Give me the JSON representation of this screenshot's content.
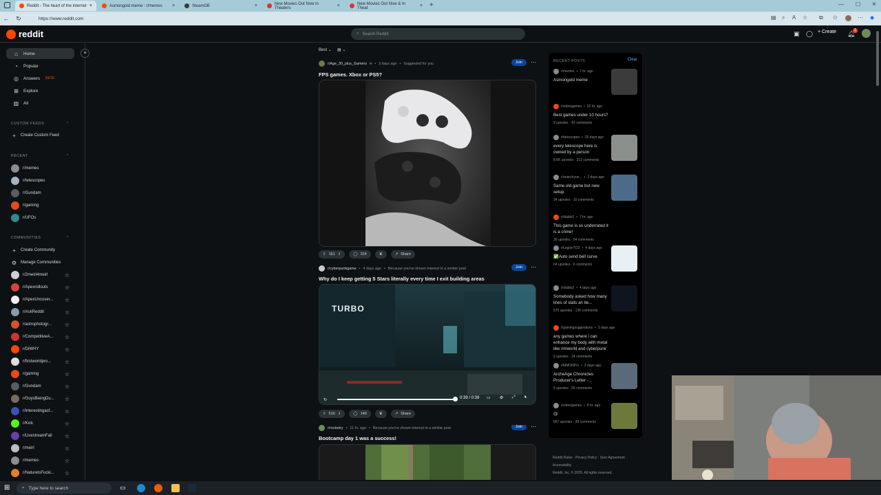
{
  "browser": {
    "tabs": [
      {
        "label": "Reddit - The heart of the internet",
        "active": true,
        "color": "#ff4500"
      },
      {
        "label": "Asmongold meme : r/memes",
        "active": false,
        "color": "#ff4500"
      },
      {
        "label": "SteamDB",
        "active": false,
        "color": "#3a3a3a"
      },
      {
        "label": "New Movies Out Now in Theaters",
        "active": false,
        "color": "#e0332f"
      },
      {
        "label": "New Movies Out Now & In Theat",
        "active": false,
        "color": "#e0332f"
      }
    ],
    "new_tab_icon": "plus-icon",
    "url": "https://www.reddit.com"
  },
  "header": {
    "logo_text": "reddit",
    "search_placeholder": "Search Reddit",
    "create_label": "Create",
    "notification_count": "1"
  },
  "sidebar": {
    "nav": [
      {
        "label": "Home",
        "icon": "home-icon",
        "active": true
      },
      {
        "label": "Popular",
        "icon": "popular-icon"
      },
      {
        "label": "Answers",
        "icon": "answers-icon",
        "badge": "BETA"
      },
      {
        "label": "Explore",
        "icon": "explore-icon"
      },
      {
        "label": "All",
        "icon": "all-icon"
      }
    ],
    "custom_feeds_heading": "CUSTOM FEEDS",
    "create_custom_feed": "Create Custom Feed",
    "recent_heading": "RECENT",
    "recent": [
      {
        "label": "r/memes",
        "color": "#8c8c8c"
      },
      {
        "label": "r/telescopes",
        "color": "#a5b3c0"
      },
      {
        "label": "r/Gundam",
        "color": "#555e64"
      },
      {
        "label": "r/gaming",
        "color": "#e64a19"
      },
      {
        "label": "r/UFOs",
        "color": "#2e8b8b"
      }
    ],
    "communities_heading": "COMMUNITIES",
    "create_community": "Create Community",
    "manage_communities": "Manage Communities",
    "communities": [
      {
        "label": "r/2meirl4meirl",
        "color": "#cfcfcf"
      },
      {
        "label": "r/Apexrollouts",
        "color": "#d1453b"
      },
      {
        "label": "r/ApexUncover...",
        "color": "#f0f0f0"
      },
      {
        "label": "r/AskReddit",
        "color": "#8a9aa8"
      },
      {
        "label": "r/astrophotogr...",
        "color": "#d94f30"
      },
      {
        "label": "r/CompetitiveA...",
        "color": "#c33"
      },
      {
        "label": "r/DiWHY",
        "color": "#ff4500"
      },
      {
        "label": "r/firstworldpro...",
        "color": "#ddd"
      },
      {
        "label": "r/gaming",
        "color": "#e64a19"
      },
      {
        "label": "r/Gundam",
        "color": "#555e64"
      },
      {
        "label": "r/GuysBeingDu...",
        "color": "#7a6a5a"
      },
      {
        "label": "r/interestingasf...",
        "color": "#3f51b5"
      },
      {
        "label": "r/Kick",
        "color": "#53fc18"
      },
      {
        "label": "r/LivestreamFail",
        "color": "#6441a5"
      },
      {
        "label": "r/meirl",
        "color": "#bdbdbd"
      },
      {
        "label": "r/memes",
        "color": "#8c8c8c"
      },
      {
        "label": "r/NatureIsFucki...",
        "color": "#e67e22"
      }
    ]
  },
  "feed": {
    "sort_label": "Best",
    "posts": [
      {
        "subreddit": "r/Age_30_plus_Gamers",
        "time": "3 days ago",
        "reason": "Suggested for you",
        "join": "Join",
        "title": "FPS games. Xbox or PS5?",
        "upvotes": "161",
        "comments": "314",
        "share": "Share"
      },
      {
        "subreddit": "r/cyberpunkgame",
        "time": "4 days ago",
        "reason": "Because you've shown interest in a similar post",
        "join": "Join",
        "title": "Why do I keep getting 5 Stars literally every time I exit building areas",
        "video_time": "0:39 / 0:39",
        "video_overlay": "TURBO",
        "upvotes": "516",
        "comments": "149",
        "share": "Share"
      },
      {
        "subreddit": "r/rocketry",
        "time": "11 hr. ago",
        "reason": "Because you've shown interest in a similar post",
        "join": "Join",
        "title": "Bootcamp day 1 was a success!"
      }
    ]
  },
  "rail": {
    "heading": "RECENT POSTS",
    "clear": "Clear",
    "items": [
      {
        "sub": "r/memes",
        "time": "7 hr. ago",
        "title": "Asmongold meme",
        "stats": "",
        "thumb": "#3b3b3b"
      },
      {
        "sub": "r/videogames",
        "time": "22 hr. ago",
        "title": "Best games under 10 hours?",
        "stats": "9 upvotes · 43 comments",
        "thumb": ""
      },
      {
        "sub": "r/telescopes",
        "time": "25 days ago",
        "title": "every telescope here is owned by a person",
        "stats": "8.6K upvotes · 212 comments",
        "thumb": "#8a8f8c"
      },
      {
        "sub": "r/anarchyon...",
        "time": "2 days ago",
        "title": "Same old game but new setup.",
        "stats": "34 upvotes · 10 comments",
        "thumb": "#4c6b8a"
      },
      {
        "sub": "r/diablo2",
        "time": "7 hr. ago",
        "title": "This game is so underrated it is a crime!",
        "stats": "36 upvotes · 54 comments",
        "thumb": ""
      },
      {
        "sub": "r/LegionTD2",
        "time": "4 days ago",
        "title": "✅Auto send bell curve",
        "stats": "64 upvotes · 6 comments",
        "thumb": "#e8f0f5"
      },
      {
        "sub": "r/diablo2",
        "time": "4 days ago",
        "title": "Somebody asked how many lines of stats an ite...",
        "stats": "570 upvotes · 136 comments",
        "thumb": "#0e1420"
      },
      {
        "sub": "r/gamingsuggestions",
        "time": "3 days ago",
        "title": "any games where i can enhance my body with metal like rimworld and cyberpunk",
        "stats": "6 upvotes · 24 comments",
        "thumb": ""
      },
      {
        "sub": "r/MMORPG",
        "time": "3 days ago",
        "title": "ArcheAge Chronicles Producer's Letter -...",
        "stats": "5 upvotes · 55 comments",
        "thumb": "#5a6a78"
      },
      {
        "sub": "r/videogames",
        "time": "8 hr. ago",
        "title": "😢",
        "stats": "567 upvotes · 39 comments",
        "thumb": "#6b7a3a"
      }
    ]
  },
  "footer": {
    "rules": "Reddit Rules",
    "privacy": "Privacy Policy",
    "agreement": "User Agreement",
    "accessibility": "Accessibility",
    "copyright": "Reddit, Inc. © 2025. All rights reserved."
  },
  "taskbar": {
    "search_placeholder": "Type here to search"
  }
}
